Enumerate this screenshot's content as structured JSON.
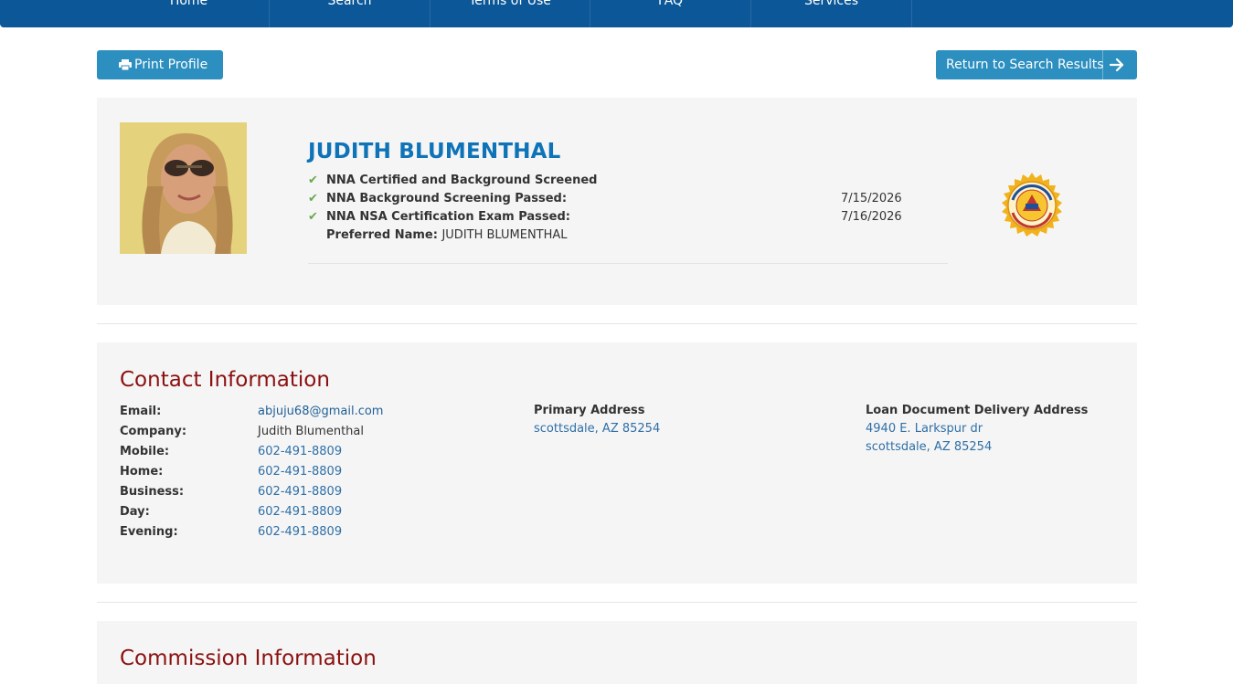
{
  "nav": {
    "items": [
      {
        "label": "Home"
      },
      {
        "label": "Search"
      },
      {
        "label": "Terms of Use"
      },
      {
        "label": "FAQ"
      },
      {
        "label": "Services"
      }
    ]
  },
  "toolbar": {
    "print_label": "Print Profile",
    "return_label": "Return to Search Results"
  },
  "profile": {
    "name": "JUDITH BLUMENTHAL",
    "certs": [
      {
        "label": "NNA Certified and Background Screened",
        "date": ""
      },
      {
        "label": "NNA Background Screening Passed:",
        "date": "7/15/2026"
      },
      {
        "label": "NNA NSA Certification Exam Passed:",
        "date": "7/16/2026"
      }
    ],
    "preferred_label": "Preferred Name:",
    "preferred_value": "JUDITH BLUMENTHAL"
  },
  "contact": {
    "title": "Contact Information",
    "rows": [
      {
        "label": "Email:",
        "value": "abjuju68@gmail.com"
      },
      {
        "label": "Company:",
        "value": "Judith Blumenthal"
      },
      {
        "label": "Mobile:",
        "value": "602-491-8809"
      },
      {
        "label": "Home:",
        "value": "602-491-8809"
      },
      {
        "label": "Business:",
        "value": "602-491-8809"
      },
      {
        "label": "Day:",
        "value": "602-491-8809"
      },
      {
        "label": "Evening:",
        "value": "602-491-8809"
      }
    ],
    "primary_address": {
      "heading": "Primary Address",
      "lines": [
        "scottsdale, AZ 85254"
      ]
    },
    "loan_address": {
      "heading": "Loan Document Delivery Address",
      "lines": [
        "4940 E. Larkspur dr",
        "scottsdale, AZ 85254"
      ]
    }
  },
  "commission": {
    "title": "Commission Information"
  },
  "colors": {
    "nav_bg": "#0b5797",
    "button": "#2c8fbf",
    "name": "#0f73b8",
    "section_title": "#8b1010",
    "link": "#2e6fa7",
    "check": "#6aa84f"
  },
  "icons": [
    "printer-icon",
    "arrow-right-icon",
    "check-icon",
    "certified-seal-icon"
  ]
}
